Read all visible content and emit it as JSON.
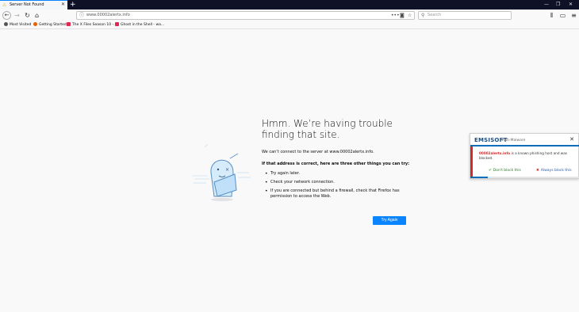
{
  "tab": {
    "title": "Server Not Found",
    "icon": "warning-icon",
    "close": "✕"
  },
  "window_controls": {
    "minimize": "—",
    "restore": "❐",
    "close": "✕"
  },
  "new_tab": "+",
  "nav": {
    "url": "www.00002alertx.info",
    "search_placeholder": "Search",
    "page_actions": "•••"
  },
  "bookmarks": [
    {
      "label": "Most Visited",
      "icon": "gear-icon",
      "color": "#555555"
    },
    {
      "label": "Getting Started",
      "icon": "firefox-icon",
      "color": "#e66000"
    },
    {
      "label": "The X Files Season 10 -...",
      "icon": "site-icon",
      "color": "#e22850"
    },
    {
      "label": "Ghost in the Shell - wa...",
      "icon": "site-icon",
      "color": "#e22850"
    }
  ],
  "error": {
    "headline": "Hmm. We’re having trouble finding that site.",
    "description": "We can’t connect to the server at www.00002alertx.info.",
    "subheading": "If that address is correct, here are three other things you can try:",
    "suggestions": [
      "Try again later.",
      "Check your network connection.",
      "If you are connected but behind a firewall, check that Firefox has permission to access the Web."
    ],
    "try_again": "Try Again"
  },
  "popup": {
    "brand_ems": "EMS",
    "brand_isoft": "ISOFT",
    "product": "Anti-Malware",
    "host": "00002alertx.info",
    "message_tail": " is a known phishing host and was blocked.",
    "dont_block": "Don't block this",
    "always_block": "Always block this",
    "progress": 0.16
  },
  "colors": {
    "accent": "#0a84ff",
    "danger": "#d12b2b",
    "brand": "#1c4e80"
  }
}
